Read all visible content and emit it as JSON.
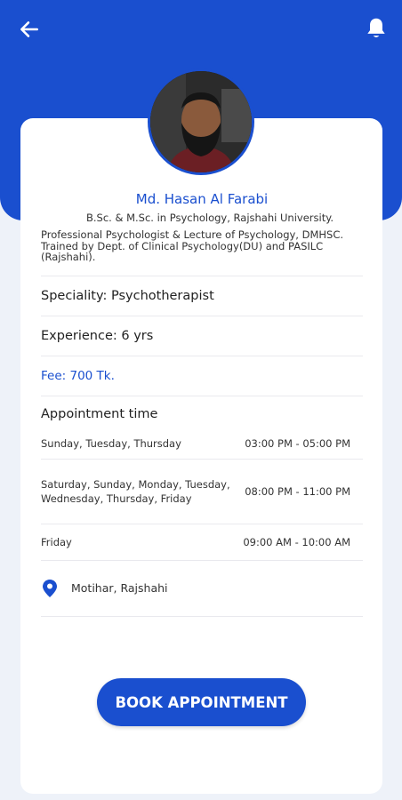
{
  "header": {
    "back_icon": "arrow-left-icon",
    "notification_icon": "bell-icon"
  },
  "colors": {
    "primary": "#1a4fcf",
    "background": "#eef2f9",
    "card": "#ffffff"
  },
  "doctor": {
    "name": "Md. Hasan Al Farabi",
    "degree": "B.Sc. & M.Sc. in Psychology, Rajshahi University.",
    "bio": "Professional Psychologist & Lecture of Psychology, DMHSC.\nTrained by Dept. of Clinical Psychology(DU) and PASILC (Rajshahi).",
    "speciality": "Speciality: Psychotherapist",
    "experience": "Experience: 6 yrs",
    "fee": "Fee: 700 Tk."
  },
  "appointment": {
    "title": "Appointment time",
    "schedule": [
      {
        "days": "Sunday, Tuesday, Thursday",
        "time": "03:00 PM - 05:00 PM"
      },
      {
        "days": "Saturday, Sunday, Monday, Tuesday, Wednesday, Thursday, Friday",
        "time": "08:00 PM - 11:00 PM"
      },
      {
        "days": "Friday",
        "time": "09:00 AM - 10:00 AM"
      }
    ]
  },
  "location": {
    "icon": "map-pin-icon",
    "text": "Motihar, Rajshahi"
  },
  "actions": {
    "book_label": "BOOK APPOINTMENT"
  }
}
